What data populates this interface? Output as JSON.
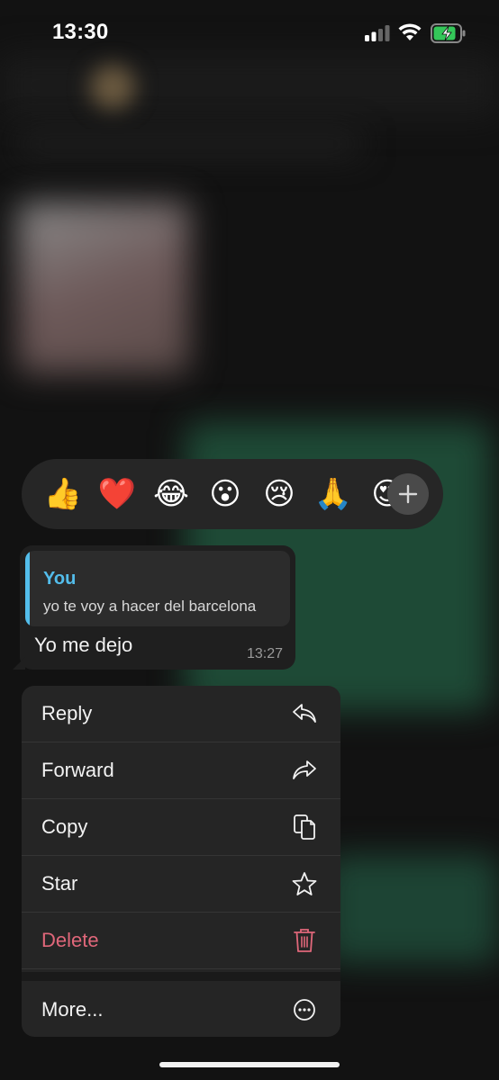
{
  "status_bar": {
    "time": "13:30"
  },
  "reactions": [
    {
      "emoji": "👍",
      "name": "thumbs-up"
    },
    {
      "emoji": "❤️",
      "name": "heart"
    },
    {
      "emoji": "😂",
      "name": "tears-of-joy"
    },
    {
      "emoji": "😮",
      "name": "surprised"
    },
    {
      "emoji": "😢",
      "name": "crying"
    },
    {
      "emoji": "🙏",
      "name": "folded-hands"
    },
    {
      "emoji": "😍",
      "name": "heart-eyes"
    }
  ],
  "message": {
    "quote_author": "You",
    "quote_text": "yo te voy a hacer del barcelona",
    "text": "Yo me dejo",
    "time": "13:27"
  },
  "menu": {
    "reply": "Reply",
    "forward": "Forward",
    "copy": "Copy",
    "star": "Star",
    "delete": "Delete",
    "more": "More..."
  },
  "colors": {
    "quote_accent": "#53bdeb",
    "delete_red": "#e0677a",
    "battery_green": "#34c759"
  }
}
